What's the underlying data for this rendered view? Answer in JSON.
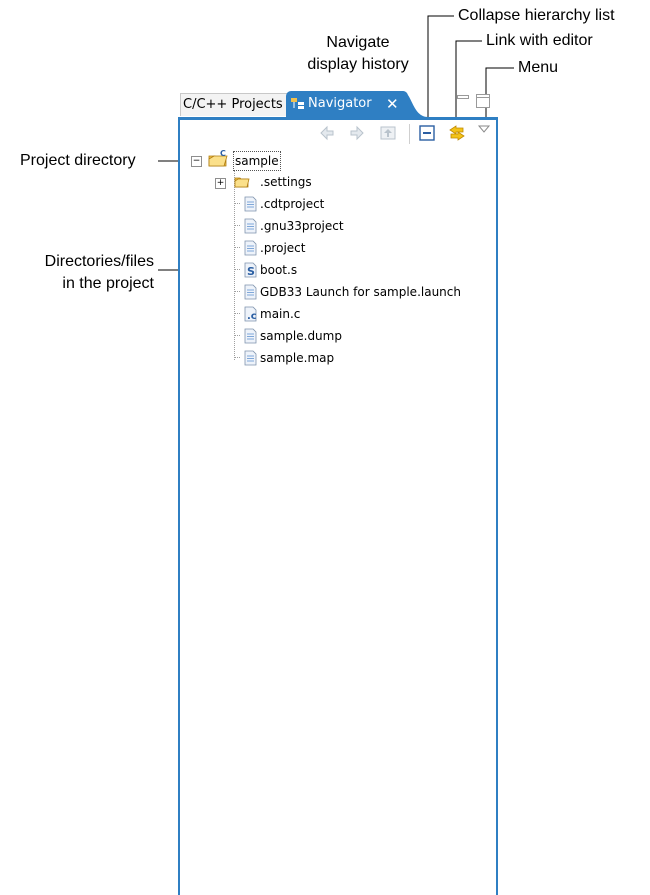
{
  "callouts": {
    "collapse": "Collapse hierarchy list",
    "link": "Link with editor",
    "menu": "Menu",
    "navigate_line1": "Navigate",
    "navigate_line2": "display history",
    "project_dir": "Project directory",
    "dirs_line1": "Directories/files",
    "dirs_line2": "in the project"
  },
  "tabs": {
    "projects": "C/C++ Projects",
    "navigator": "Navigator",
    "close_glyph": "✕"
  },
  "toolbar": {
    "back_icon": "back-arrow-icon",
    "forward_icon": "forward-arrow-icon",
    "up_icon": "up-folder-icon",
    "collapse_icon": "collapse-all-icon",
    "link_icon": "link-editor-icon",
    "menu_icon": "view-menu-icon"
  },
  "tree": {
    "root": "sample",
    "items": [
      {
        "label": ".settings",
        "icon": "folder-icon"
      },
      {
        "label": ".cdtproject",
        "icon": "file-icon"
      },
      {
        "label": ".gnu33project",
        "icon": "file-icon"
      },
      {
        "label": ".project",
        "icon": "file-icon"
      },
      {
        "label": "boot.s",
        "icon": "asm-file-icon"
      },
      {
        "label": "GDB33 Launch for sample.launch",
        "icon": "file-icon"
      },
      {
        "label": "main.c",
        "icon": "c-file-icon"
      },
      {
        "label": "sample.dump",
        "icon": "file-icon"
      },
      {
        "label": "sample.map",
        "icon": "file-icon"
      }
    ]
  },
  "colors": {
    "accent": "#2f7fc3",
    "folder": "#f2c14e",
    "link": "#e0a100"
  }
}
